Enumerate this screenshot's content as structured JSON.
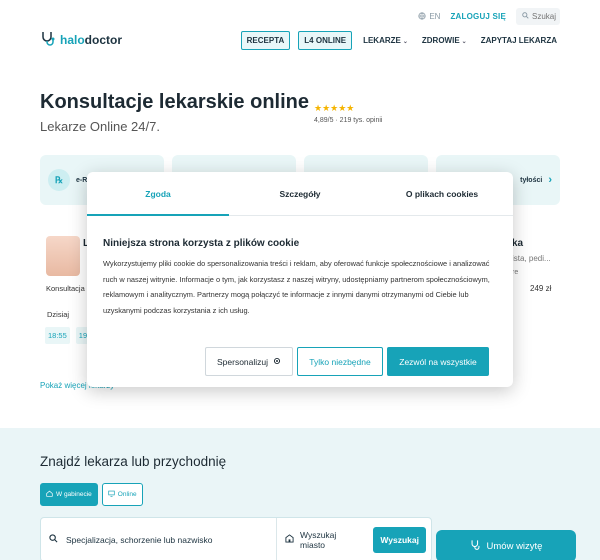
{
  "header": {
    "lang": "EN",
    "login": "ZALOGUJ SIĘ",
    "search_placeholder": "Szukaj",
    "logo_a": "halo",
    "logo_b": "doctor",
    "nav": {
      "recepta": "RECEPTA",
      "l4": "L4 ONLINE",
      "lekarze": "LEKARZE",
      "zdrowie": "ZDROWIE",
      "zapytaj": "ZAPYTAJ LEKARZA"
    }
  },
  "hero": {
    "title": "Konsultacje lekarskie online",
    "subtitle": "Lekarze Online 24/7.",
    "stars": "★★★★★",
    "rating": "4,89/5 · 219 tys. opinii"
  },
  "cards": {
    "first": "e-R",
    "last": "tyłości"
  },
  "doctor_behind": {
    "name_initial": "L",
    "consult": "Konsultacja l",
    "today": "Dzisiaj",
    "slots": [
      "18:55",
      "19:2"
    ],
    "right_name": "ka",
    "right_spec": "ista, pedi...",
    "right_note": "re",
    "price": "249 zł",
    "more": "Pokaż więcej lekarzy"
  },
  "find": {
    "title": "Znajdź lekarza lub przychodnię",
    "toggle_gabinet": "W gabinecie",
    "toggle_online": "Online",
    "spec_placeholder": "Specjalizacja, schorzenie lub nazwisko",
    "city_placeholder": "Wyszukaj miasto",
    "search_button": "Wyszukaj",
    "book_button": "Umów wizytę"
  },
  "cookie_modal": {
    "tabs": [
      "Zgoda",
      "Szczegóły",
      "O plikach cookies"
    ],
    "title": "Niniejsza strona korzysta z plików cookie",
    "text": "Wykorzystujemy pliki cookie do spersonalizowania treści i reklam, aby oferować funkcje społecznościowe i analizować ruch w naszej witrynie. Informacje o tym, jak korzystasz z naszej witryny, udostępniamy partnerom społecznościowym, reklamowym i analitycznym. Partnerzy mogą połączyć te informacje z innymi danymi otrzymanymi od Ciebie lub uzyskanymi podczas korzystania z ich usług.",
    "btn_personalize": "Spersonalizuj",
    "btn_necessary": "Tylko niezbędne",
    "btn_allow_all": "Zezwól na wszystkie"
  },
  "colors": {
    "accent": "#17a3b8",
    "dark": "#1d2a33",
    "light_teal": "#e9f6f7"
  }
}
